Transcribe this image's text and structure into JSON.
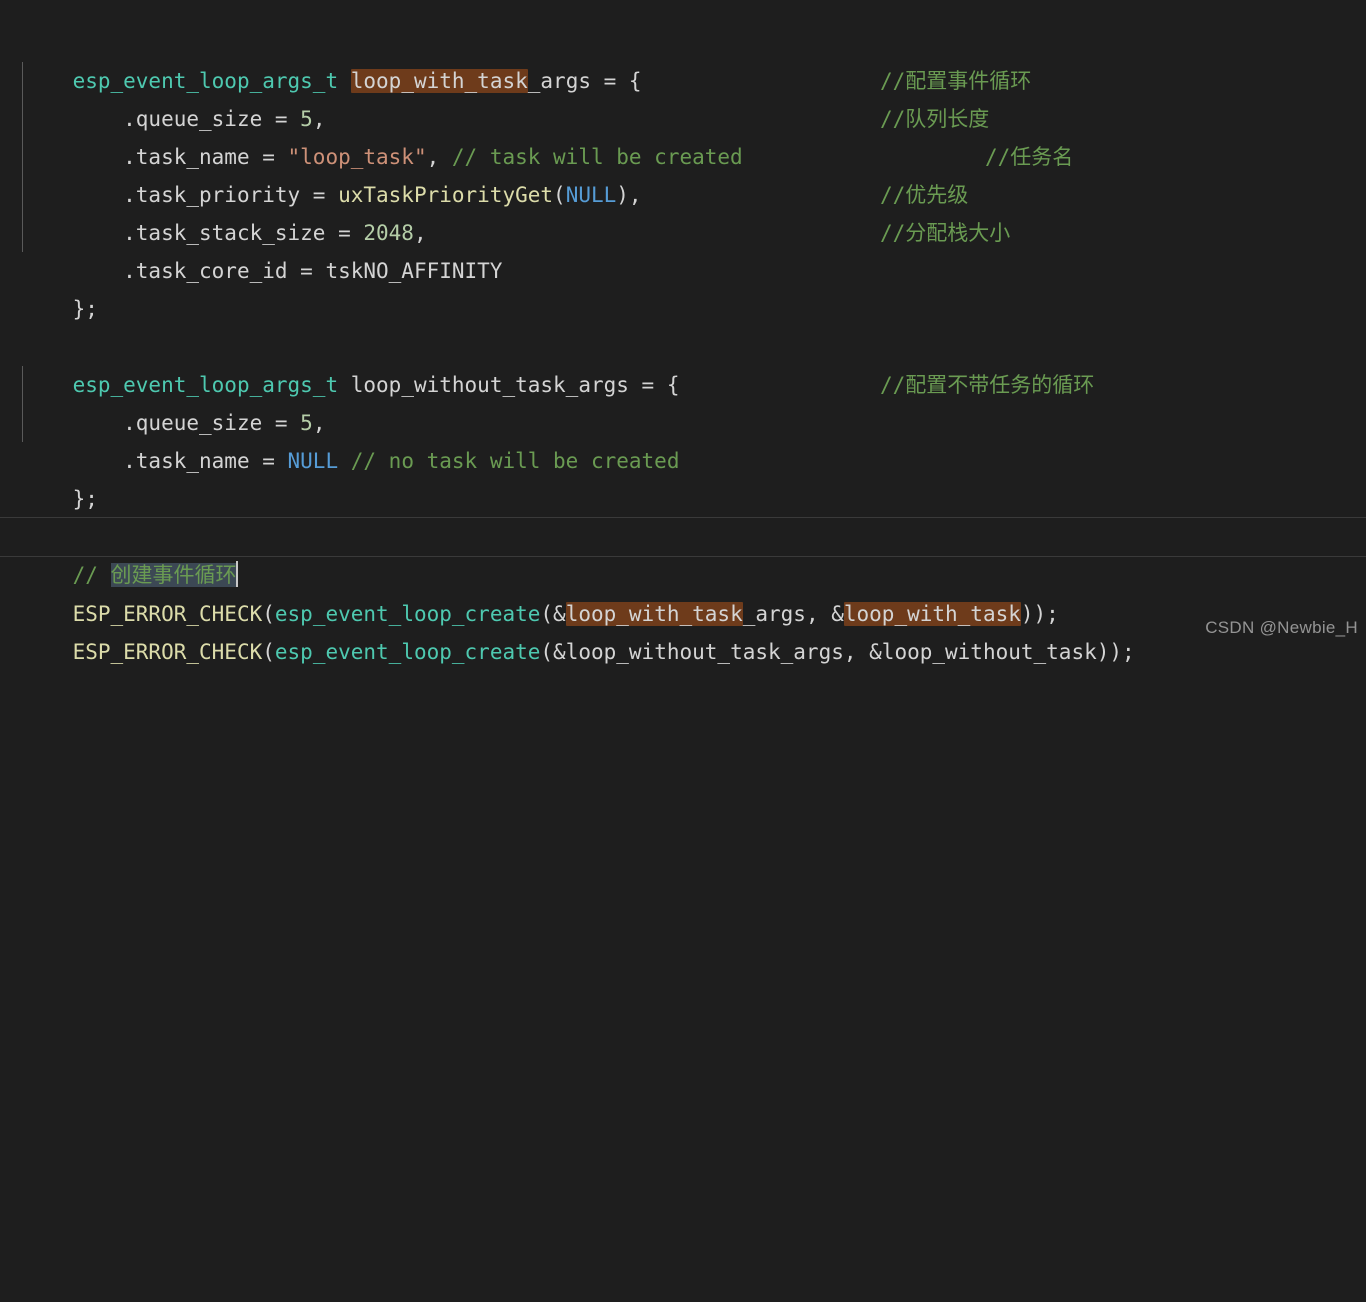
{
  "editor": {
    "background_color": "#1e1e1e",
    "foreground_color": "#d4d4d4",
    "language": "c",
    "colors": {
      "type": "#4ec9b0",
      "comment": "#6a9b52",
      "string": "#ce9178",
      "number": "#b5cea8",
      "keyword": "#569cd6",
      "function": "#dcdcaa",
      "word_highlight": "#6e3b1b",
      "selection": "#3c4854",
      "caret": "#c8c8c8",
      "indent_guide": "#5a5a5a",
      "current_line_border": "#3a3a3a"
    }
  },
  "code": {
    "line1": {
      "type": "esp_event_loop_args_t",
      "sp1": " ",
      "name_highlighted": "loop_with_task",
      "name_rest": "_args",
      "tail": " = {",
      "comment": "//配置事件循环"
    },
    "line2": {
      "text": "    .queue_size = ",
      "number": "5",
      "tail": ",",
      "comment": "//队列长度"
    },
    "line3": {
      "text": "    .task_name = ",
      "string": "\"loop_task\"",
      "tail": ", ",
      "comment_inline": "// task will be created",
      "gap": "          ",
      "comment": "//任务名"
    },
    "line4": {
      "text": "    .task_priority = ",
      "func": "uxTaskPriorityGet",
      "paren_open": "(",
      "keyword": "NULL",
      "paren_close": "),",
      "comment": "//优先级"
    },
    "line5": {
      "text": "    .task_stack_size = ",
      "number": "2048",
      "tail": ",",
      "comment": "//分配栈大小"
    },
    "line6": {
      "text": "    .task_core_id = tskNO_AFFINITY"
    },
    "line7": {
      "text": "};"
    },
    "line8": {
      "text": ""
    },
    "line9": {
      "type": "esp_event_loop_args_t",
      "sp1": " ",
      "name": "loop_without_task_args",
      "tail": " = {",
      "comment": "//配置不带任务的循环"
    },
    "line10": {
      "text": "    .queue_size = ",
      "number": "5",
      "tail": ","
    },
    "line11": {
      "text": "    .task_name = ",
      "keyword": "NULL",
      "sp": " ",
      "comment": "// no task will be created"
    },
    "line12": {
      "text": "};"
    },
    "line13": {
      "text": ""
    },
    "line14": {
      "comment_prefix": "// ",
      "comment_selected": "创建事件循环"
    },
    "line15": {
      "macro": "ESP_ERROR_CHECK",
      "paren_open": "(",
      "func": "esp_event_loop_create",
      "paren_open2": "(&",
      "arg1_highlighted": "loop_with_task",
      "arg1_rest": "_args",
      "sep": ", &",
      "arg2_highlighted": "loop_with_task",
      "tail": "));"
    },
    "line16": {
      "macro": "ESP_ERROR_CHECK",
      "paren_open": "(",
      "func": "esp_event_loop_create",
      "paren_open2": "(&",
      "arg1": "loop_without_task_args",
      "sep": ", &",
      "arg2": "loop_without_task",
      "tail": "));"
    }
  },
  "watermark": {
    "text": "CSDN @Newbie_H"
  }
}
